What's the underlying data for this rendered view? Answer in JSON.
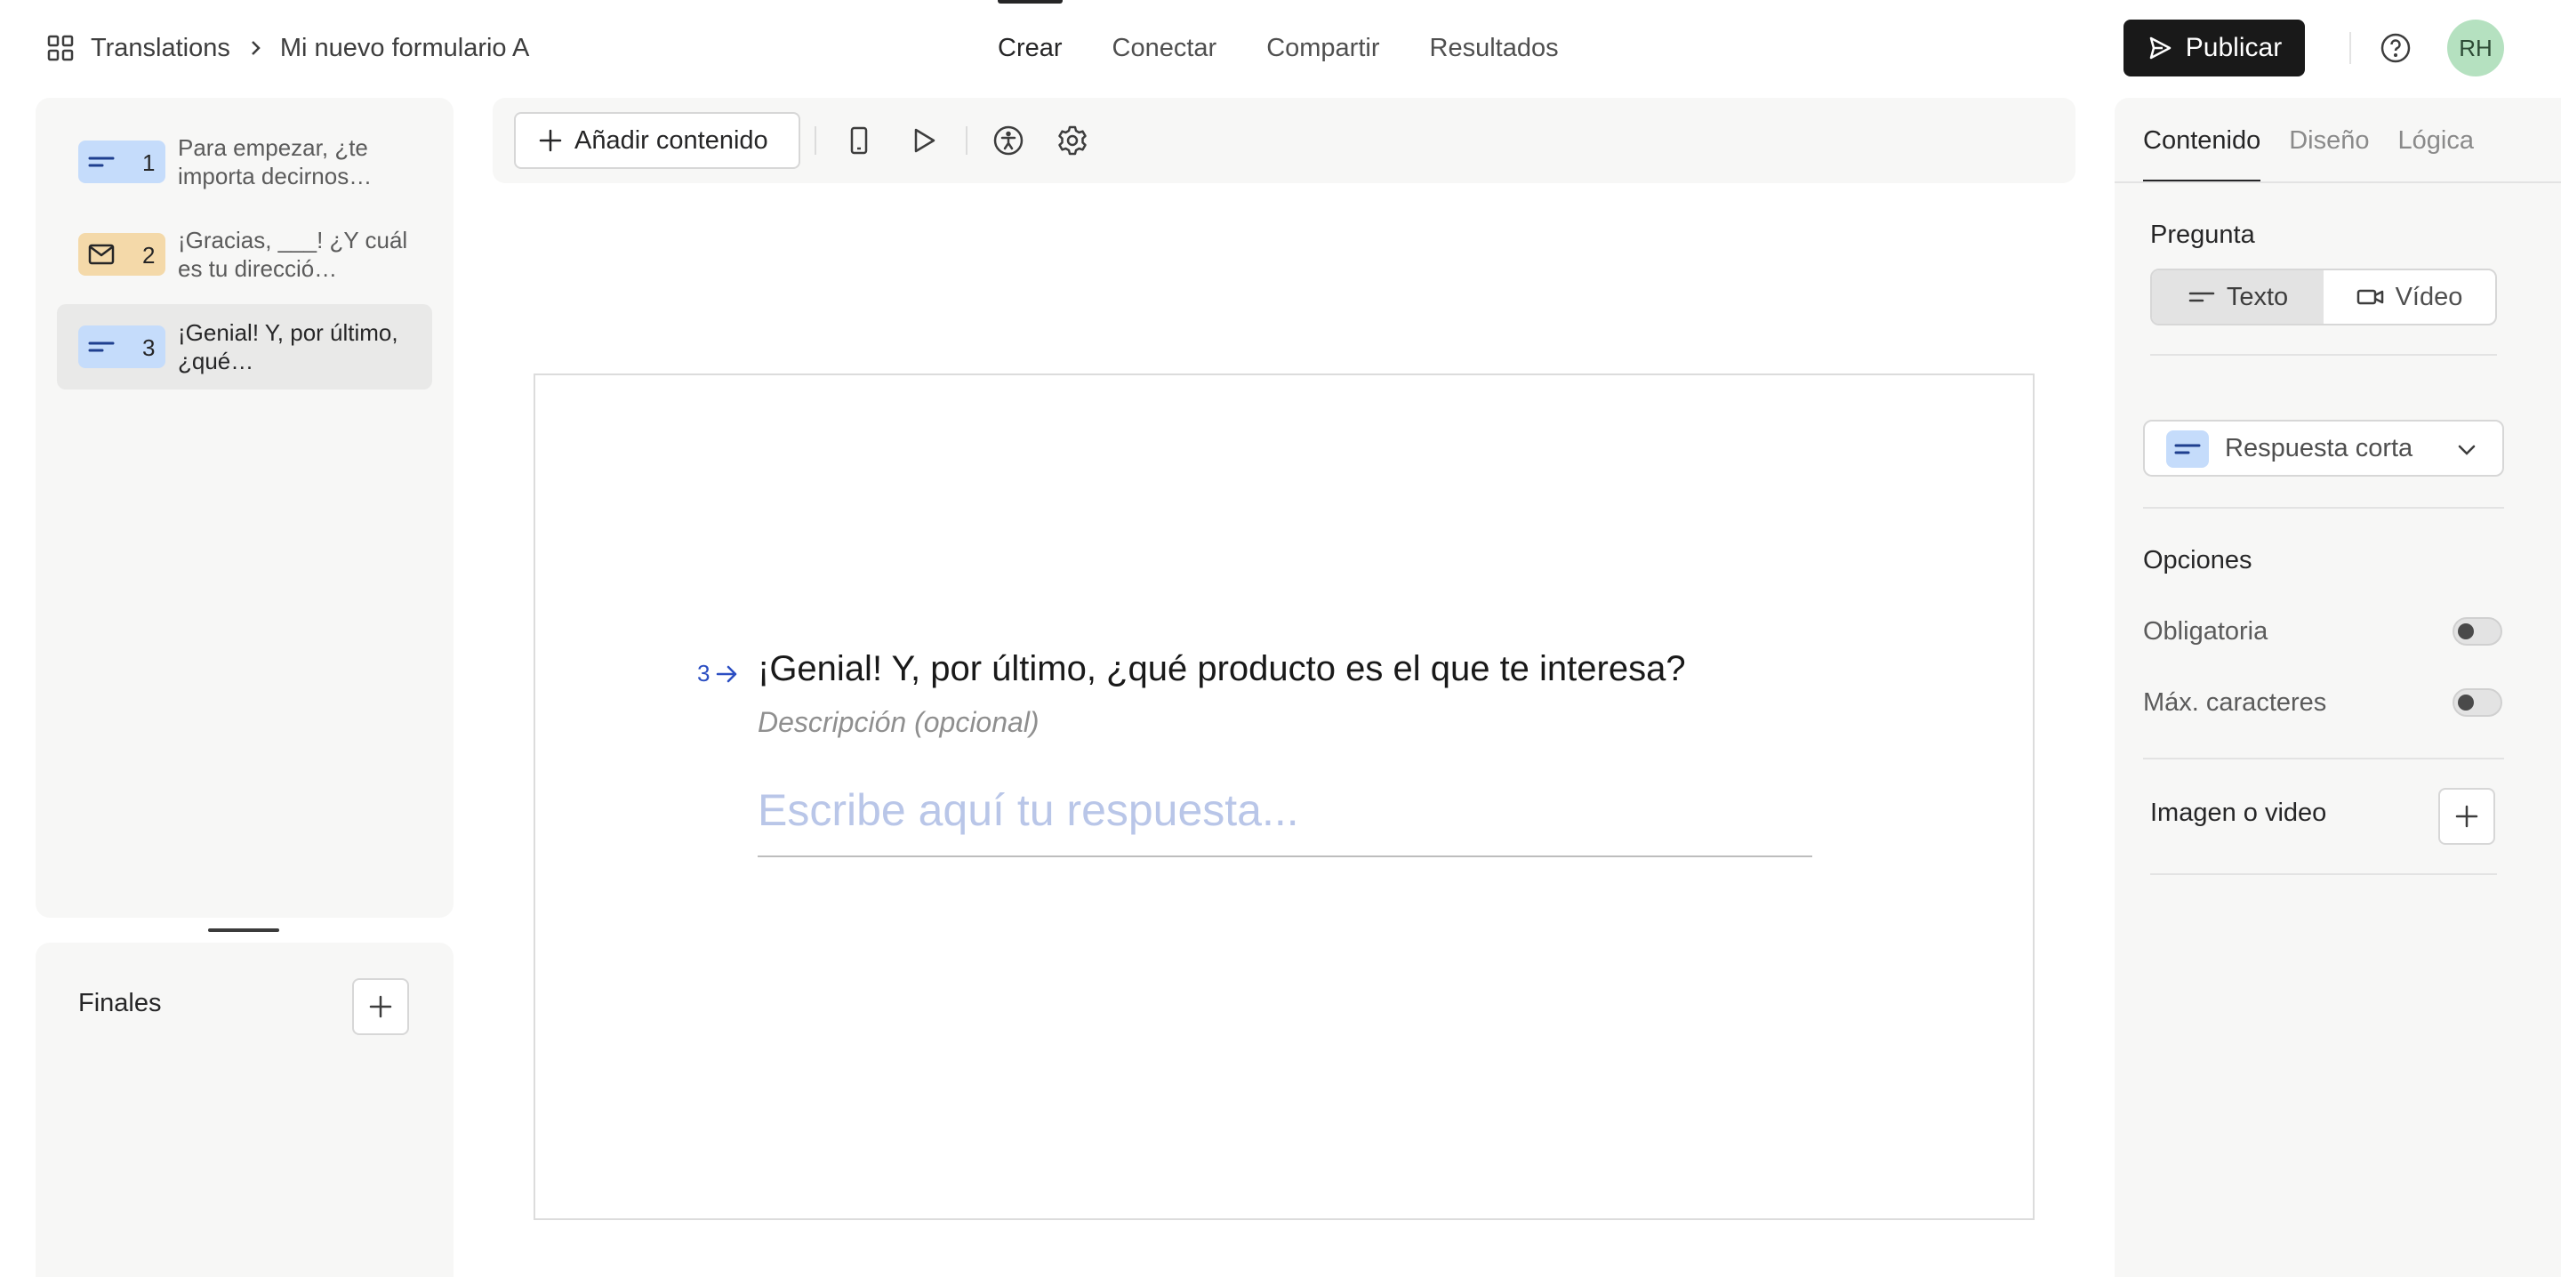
{
  "breadcrumb": {
    "root": "Translations",
    "current": "Mi nuevo formulario A"
  },
  "nav": {
    "tabs": [
      "Crear",
      "Conectar",
      "Compartir",
      "Resultados"
    ],
    "active": "Crear"
  },
  "header": {
    "publish_label": "Publicar",
    "avatar_initials": "RH"
  },
  "questions": [
    {
      "number": "1",
      "text": "Para empezar, ¿te importa decirnos…",
      "icon": "short-text-icon",
      "color": "#c5dcfb"
    },
    {
      "number": "2",
      "text": "¡Gracias, ___! ¿Y cuál es tu direcció…",
      "icon": "email-icon",
      "color": "#f4d9a9"
    },
    {
      "number": "3",
      "text": "¡Genial! Y, por último, ¿qué…",
      "icon": "short-text-icon",
      "color": "#c5dcfb",
      "selected": true
    }
  ],
  "endings": {
    "label": "Finales"
  },
  "toolbar": {
    "add_content_label": "Añadir contenido"
  },
  "canvas": {
    "question_number": "3",
    "question_title": "¡Genial! Y, por último, ¿qué producto es el que te interesa?",
    "description_placeholder": "Descripción (opcional)",
    "answer_placeholder": "Escribe aquí tu respuesta..."
  },
  "right_panel": {
    "tabs": [
      "Contenido",
      "Diseño",
      "Lógica"
    ],
    "active_tab": "Contenido",
    "question_label": "Pregunta",
    "question_modes": [
      "Texto",
      "Vídeo"
    ],
    "active_mode": "Texto",
    "question_type": "Respuesta corta",
    "options_label": "Opciones",
    "options": [
      {
        "label": "Obligatoria",
        "enabled": false
      },
      {
        "label": "Máx. caracteres",
        "enabled": false
      }
    ],
    "media_label": "Imagen o video"
  },
  "colors": {
    "accent_text": "#2b4ec2",
    "publish_bg": "#191919",
    "avatar_bg": "#b5e1c0"
  }
}
